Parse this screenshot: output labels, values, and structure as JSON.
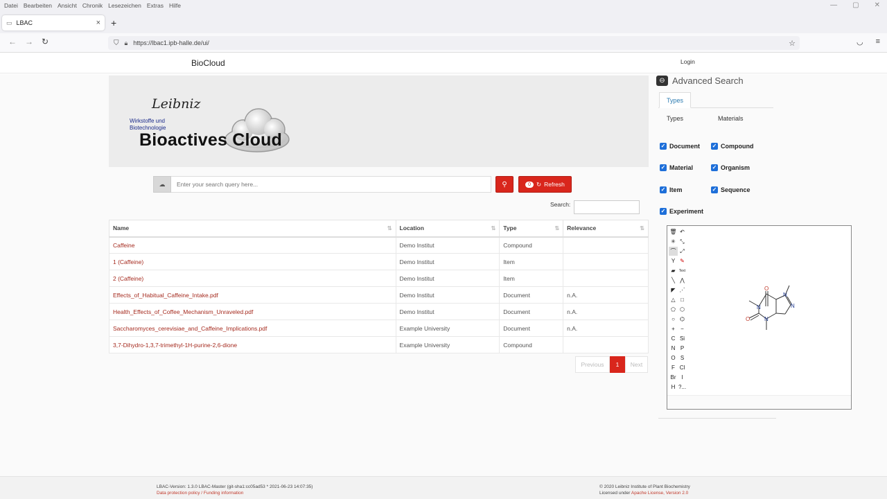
{
  "browser": {
    "menu": [
      "Datei",
      "Bearbeiten",
      "Ansicht",
      "Chronik",
      "Lesezeichen",
      "Extras",
      "Hilfe"
    ],
    "tab_title": "LBAC",
    "url": "https://lbac1.ipb-halle.de/ui/"
  },
  "header": {
    "brand": "BioCloud",
    "login": "Login"
  },
  "banner": {
    "leibniz": "Leibniz",
    "institute_line1": "Wirkstoffe und",
    "institute_line2": "Biotechnologie",
    "logo_text": "Bioactives Cloud"
  },
  "search": {
    "placeholder": "Enter your search query here...",
    "refresh_count": "0",
    "refresh_label": "Refresh",
    "table_search_label": "Search:"
  },
  "table": {
    "columns": [
      "Name",
      "Location",
      "Type",
      "Relevance"
    ],
    "rows": [
      {
        "name": "Caffeine",
        "location": "Demo Institut",
        "type": "Compound",
        "relevance": ""
      },
      {
        "name": "1 (Caffeine)",
        "location": "Demo Institut",
        "type": "Item",
        "relevance": ""
      },
      {
        "name": "2 (Caffeine)",
        "location": "Demo Institut",
        "type": "Item",
        "relevance": ""
      },
      {
        "name": "Effects_of_Habitual_Caffeine_Intake.pdf",
        "location": "Demo Institut",
        "type": "Document",
        "relevance": "n.A."
      },
      {
        "name": "Health_Effects_of_Coffee_Mechanism_Unraveled.pdf",
        "location": "Demo Institut",
        "type": "Document",
        "relevance": "n.A."
      },
      {
        "name": "Saccharomyces_cerevisiae_and_Caffeine_Implications.pdf",
        "location": "Example University",
        "type": "Document",
        "relevance": "n.A."
      },
      {
        "name": "3,7-Dihydro-1,3,7-trimethyl-1H-purine-2,6-dione",
        "location": "Example University",
        "type": "Compound",
        "relevance": ""
      }
    ]
  },
  "pagination": {
    "previous": "Previous",
    "current": "1",
    "next": "Next"
  },
  "advanced_search": {
    "title": "Advanced Search",
    "tab": "Types",
    "col_types": "Types",
    "col_materials": "Materials",
    "checkboxes": {
      "document": "Document",
      "compound": "Compound",
      "material": "Material",
      "organism": "Organism",
      "item": "Item",
      "sequence": "Sequence",
      "experiment": "Experiment"
    }
  },
  "editor": {
    "tools_text": [
      "Text",
      "C",
      "Si",
      "N",
      "P",
      "O",
      "S",
      "F",
      "Cl",
      "Br",
      "I",
      "H",
      "?..."
    ],
    "atoms": [
      "O",
      "N",
      "N",
      "O",
      "N",
      "N"
    ]
  },
  "footer": {
    "version": "LBAC-Version: 1.3.0 LBAC-Master (git-sha1:cc05ad53 * 2021-06-23 14:07:35)",
    "links": "Data protection policy / Funding information",
    "copyright": "© 2020 Leibniz Institute of Plant Biochemistry",
    "license_prefix": "Licensed under",
    "license_link": "Apache License, Version 2.0"
  },
  "colors": {
    "accent_red": "#d9261c",
    "link_red": "#a52a1e",
    "checkbox_blue": "#1e6fd9"
  }
}
